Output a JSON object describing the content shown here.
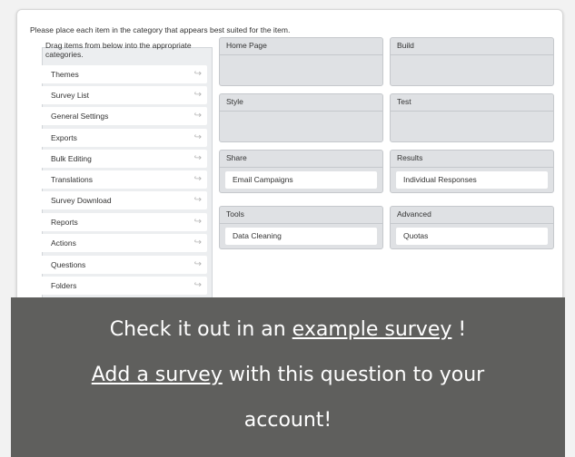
{
  "instruction": "Please place each item in the category that appears best suited for the item.",
  "source": {
    "header": "Drag items from below into the appropriate categories.",
    "items": [
      "Themes",
      "Survey List",
      "General Settings",
      "Exports",
      "Bulk Editing",
      "Translations",
      "Survey Download",
      "Reports",
      "Actions",
      "Questions",
      "Folders"
    ]
  },
  "buckets": {
    "home_page": {
      "title": "Home Page"
    },
    "build": {
      "title": "Build"
    },
    "style": {
      "title": "Style"
    },
    "test": {
      "title": "Test"
    },
    "share": {
      "title": "Share",
      "item": "Email Campaigns"
    },
    "results": {
      "title": "Results",
      "item": "Individual Responses"
    },
    "tools": {
      "title": "Tools",
      "item": "Data Cleaning"
    },
    "advanced": {
      "title": "Advanced",
      "item": "Quotas"
    }
  },
  "overlay": {
    "line1_prefix": "Check it out in an ",
    "line1_link": "example survey",
    "line1_suffix": " !",
    "line2_link": "Add a survey",
    "line2_suffix": " with this question to your",
    "line3": "account!"
  },
  "colors": {
    "overlay_bg": "#5f5f5d",
    "bucket_bg": "#dfe1e4",
    "panel_bg": "#eceef0"
  }
}
